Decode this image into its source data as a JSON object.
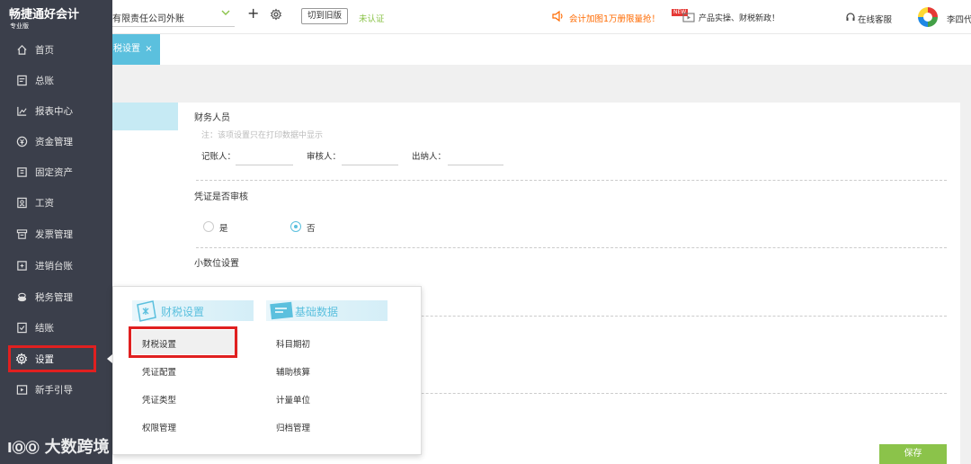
{
  "app": {
    "logo_text": "畅捷通好会计",
    "edition": "专业版"
  },
  "topbar": {
    "company_name": "有限责任公司外账",
    "switch_label": "切到旧版",
    "verify_status": "未认证",
    "promo": "会计加图1万册限量抢！",
    "new_badge": "NEW",
    "news": "产品实操、财税新政！",
    "service": "在线客服",
    "username": "李四代"
  },
  "sidebar": {
    "items": [
      {
        "label": "首页",
        "icon": "home-icon"
      },
      {
        "label": "总账",
        "icon": "ledger-icon"
      },
      {
        "label": "报表中心",
        "icon": "chart-icon"
      },
      {
        "label": "资金管理",
        "icon": "money-icon"
      },
      {
        "label": "固定资产",
        "icon": "asset-icon"
      },
      {
        "label": "工资",
        "icon": "salary-icon"
      },
      {
        "label": "发票管理",
        "icon": "invoice-icon"
      },
      {
        "label": "进销台账",
        "icon": "inventory-icon"
      },
      {
        "label": "税务管理",
        "icon": "tax-icon"
      },
      {
        "label": "结账",
        "icon": "close-account-icon"
      },
      {
        "label": "设置",
        "icon": "gear-icon"
      },
      {
        "label": "新手引导",
        "icon": "guide-icon"
      }
    ]
  },
  "tabs": [
    {
      "label": "税设置",
      "close": "×"
    }
  ],
  "settings": {
    "finance_staff": {
      "title": "财务人员",
      "note": "注：该项设置只在打印数据中显示",
      "fields": [
        {
          "label": "记账人：",
          "value": ""
        },
        {
          "label": "审核人：",
          "value": ""
        },
        {
          "label": "出纳人：",
          "value": ""
        }
      ]
    },
    "voucher_review": {
      "title": "凭证是否审核",
      "options": [
        {
          "label": "是",
          "selected": false
        },
        {
          "label": "否",
          "selected": true
        }
      ]
    },
    "decimal": {
      "title": "小数位设置"
    },
    "save_label": "保存"
  },
  "popup": {
    "col1": {
      "title": "财税设置",
      "items": [
        "财税设置",
        "凭证配置",
        "凭证类型",
        "权限管理"
      ]
    },
    "col2": {
      "title": "基础数据",
      "items": [
        "科目期初",
        "辅助核算",
        "计量单位",
        "归档管理"
      ]
    }
  },
  "watermark": "大数跨境",
  "colors": {
    "sidebar_bg": "#3b3f4b",
    "accent": "#5bc0de",
    "green": "#8bc34a",
    "highlight_red": "#e02020",
    "promo_orange": "#ff6a00"
  }
}
